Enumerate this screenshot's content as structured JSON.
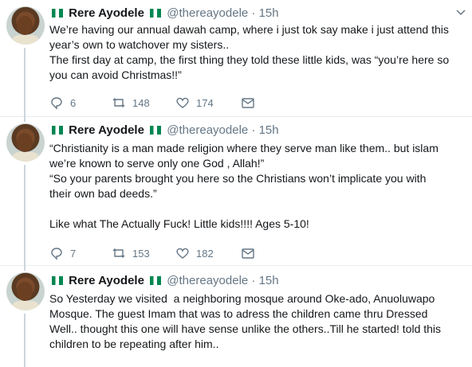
{
  "tweets": [
    {
      "name": "Rere Ayodele",
      "handle": "@thereayodele",
      "time": "15h",
      "lines": [
        "We’re having our annual dawah camp, where i just tok say make i just attend this",
        "year’s own to watchover my sisters..",
        "The first day at camp, the first thing they told these little kids, was “you’re here so",
        "you can avoid Christmas!!”"
      ],
      "replies": "6",
      "retweets": "148",
      "likes": "174"
    },
    {
      "name": "Rere Ayodele",
      "handle": "@thereayodele",
      "time": "15h",
      "lines": [
        "“Christianity is a man made religion where they serve man like them.. but islam",
        "we’re known to serve only one God , Allah!”",
        "“So your parents brought you here so the Christians won’t implicate you with",
        "their own bad deeds.”",
        "",
        "Like what The Actually Fuck! Little kids!!!! Ages 5-10!"
      ],
      "replies": "7",
      "retweets": "153",
      "likes": "182"
    },
    {
      "name": "Rere Ayodele",
      "handle": "@thereayodele",
      "time": "15h",
      "lines": [
        "So Yesterday we visited  a neighboring mosque around Oke-ado, Anuoluwapo",
        "Mosque. The guest Imam that was to adress the children came thru Dressed",
        "Well.. thought this one will have sense unlike the others..Till he started! told this",
        "children to be repeating after him.."
      ]
    }
  ],
  "colors": {
    "muted": "#657786",
    "flag_green": "#008751"
  }
}
